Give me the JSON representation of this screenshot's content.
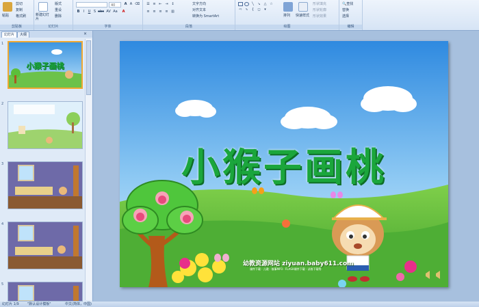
{
  "ribbon": {
    "clipboard": {
      "label": "剪贴板",
      "paste": "粘贴",
      "cut": "剪切",
      "copy": "复制",
      "format_painter": "格式刷"
    },
    "slides": {
      "label": "幻灯片",
      "new_slide": "新建幻灯片",
      "layout": "版式",
      "reset": "重设",
      "delete": "删除"
    },
    "font": {
      "label": "字体",
      "size": "40"
    },
    "paragraph": {
      "label": "段落",
      "text_direction": "文字方向",
      "align_text": "对齐文本",
      "smartart": "转换为 SmartArt"
    },
    "drawing": {
      "label": "绘图",
      "arrange": "排列",
      "quick_styles": "快速样式",
      "shape_fill": "形状填充",
      "shape_outline": "形状轮廓",
      "shape_effects": "形状效果"
    },
    "editing": {
      "label": "编辑",
      "find": "查找",
      "replace": "替换",
      "select": "选择"
    }
  },
  "panel": {
    "tabs": [
      {
        "label": "幻灯片"
      },
      {
        "label": "大纲"
      }
    ],
    "thumbnails": [
      {
        "num": "1",
        "title": "小猴子画桃"
      },
      {
        "num": "2",
        "title": ""
      },
      {
        "num": "3",
        "title": ""
      },
      {
        "num": "4",
        "title": ""
      },
      {
        "num": "5",
        "title": ""
      }
    ]
  },
  "slide": {
    "title": "小猴子画桃",
    "site": "幼教资源网站  ziyuan.baby611.com",
    "site_sub": "课件下载 · 儿歌 · 故事MP3 · FLASH课件下载 · 试卷下载等"
  },
  "status": {
    "slide_info": "幻灯片 1/9",
    "theme": "\"默认设计模板\"",
    "language": "中文(简体，中国)"
  },
  "colors": {
    "title_green": "#1ba63c",
    "sky": "#4aa3e8",
    "grass": "#6cc24a",
    "selected_border": "#f0a830"
  }
}
